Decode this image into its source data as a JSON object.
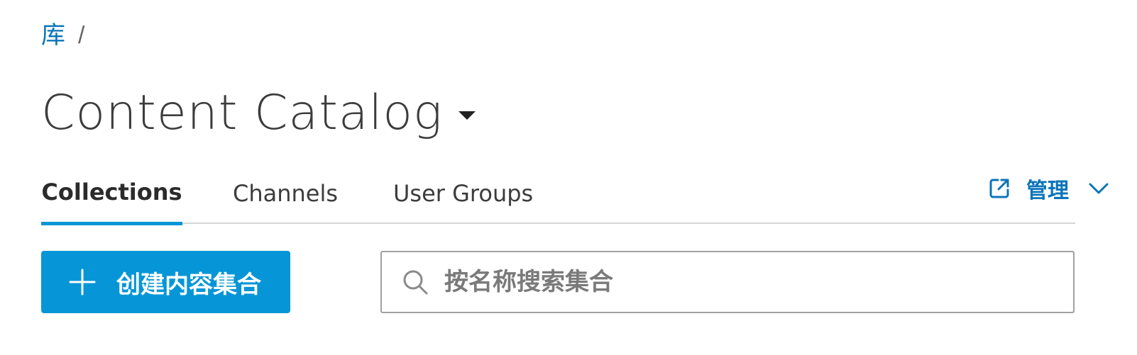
{
  "breadcrumb": {
    "root": "库",
    "separator": "/"
  },
  "header": {
    "title": "Content Catalog",
    "title_dropdown_icon": "caret-down-icon"
  },
  "tabs": [
    {
      "label": "Collections",
      "active": true
    },
    {
      "label": "Channels",
      "active": false
    },
    {
      "label": "User Groups",
      "active": false
    }
  ],
  "manage": {
    "label": "管理",
    "icon": "external-link-icon",
    "chevron_icon": "chevron-down-icon"
  },
  "toolbar": {
    "create_label": "创建内容集合",
    "create_icon": "plus-icon"
  },
  "search": {
    "placeholder": "按名称搜索集合",
    "value": "",
    "icon": "search-icon"
  },
  "colors": {
    "accent": "#0696d7",
    "link": "#0a74b8",
    "text": "#3c3c3c",
    "border": "#d5d5d5"
  }
}
